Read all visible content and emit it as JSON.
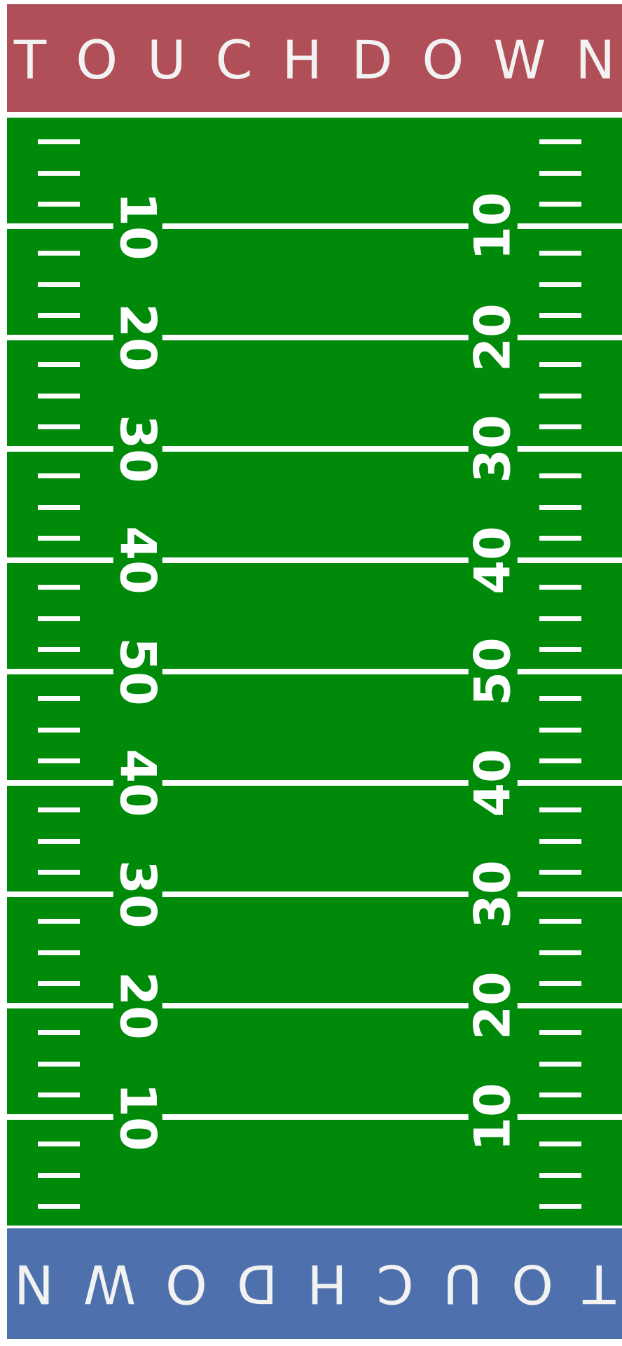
{
  "field": {
    "top_endzone_label": "TOUCHDOWN",
    "bottom_endzone_label": "TOUCHDOWN",
    "yard_numbers": [
      "10",
      "20",
      "30",
      "40",
      "50",
      "40",
      "30",
      "20",
      "10"
    ],
    "hash_marks_per_segment": 3,
    "segments": 10,
    "colors": {
      "top_endzone": "#b04f58",
      "bottom_endzone": "#4e71ad",
      "field": "#008a0a",
      "lines": "#ffffff",
      "endzone_text": "#f2f2f2"
    }
  }
}
